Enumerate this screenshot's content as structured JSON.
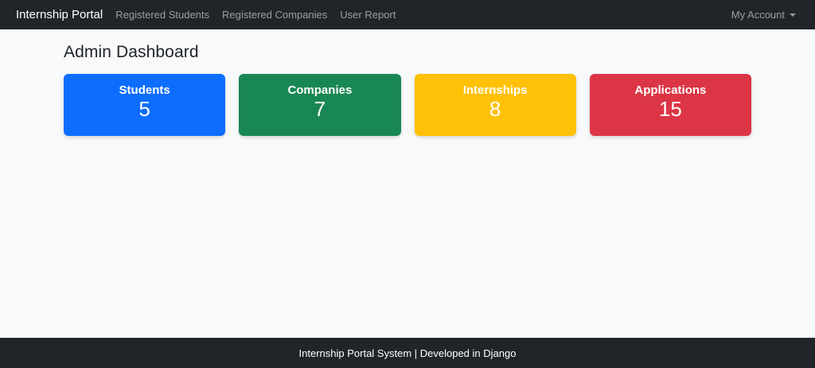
{
  "navbar": {
    "brand": "Internship Portal",
    "links": [
      {
        "label": "Registered Students"
      },
      {
        "label": "Registered Companies"
      },
      {
        "label": "User Report"
      }
    ],
    "account": {
      "label": "My Account"
    }
  },
  "main": {
    "title": "Admin Dashboard",
    "cards": [
      {
        "label": "Students",
        "value": "5",
        "color": "#0d6efd"
      },
      {
        "label": "Companies",
        "value": "7",
        "color": "#198754"
      },
      {
        "label": "Internships",
        "value": "8",
        "color": "#ffc107"
      },
      {
        "label": "Applications",
        "value": "15",
        "color": "#dc3545"
      }
    ]
  },
  "footer": {
    "text": "Internship Portal System | Developed in Django"
  },
  "colors": {
    "navbar_bg": "#212529",
    "footer_bg": "#212529",
    "page_bg": "#f8f9fa",
    "nav_link": "rgba(255,255,255,0.55)",
    "brand_text": "#ffffff"
  }
}
